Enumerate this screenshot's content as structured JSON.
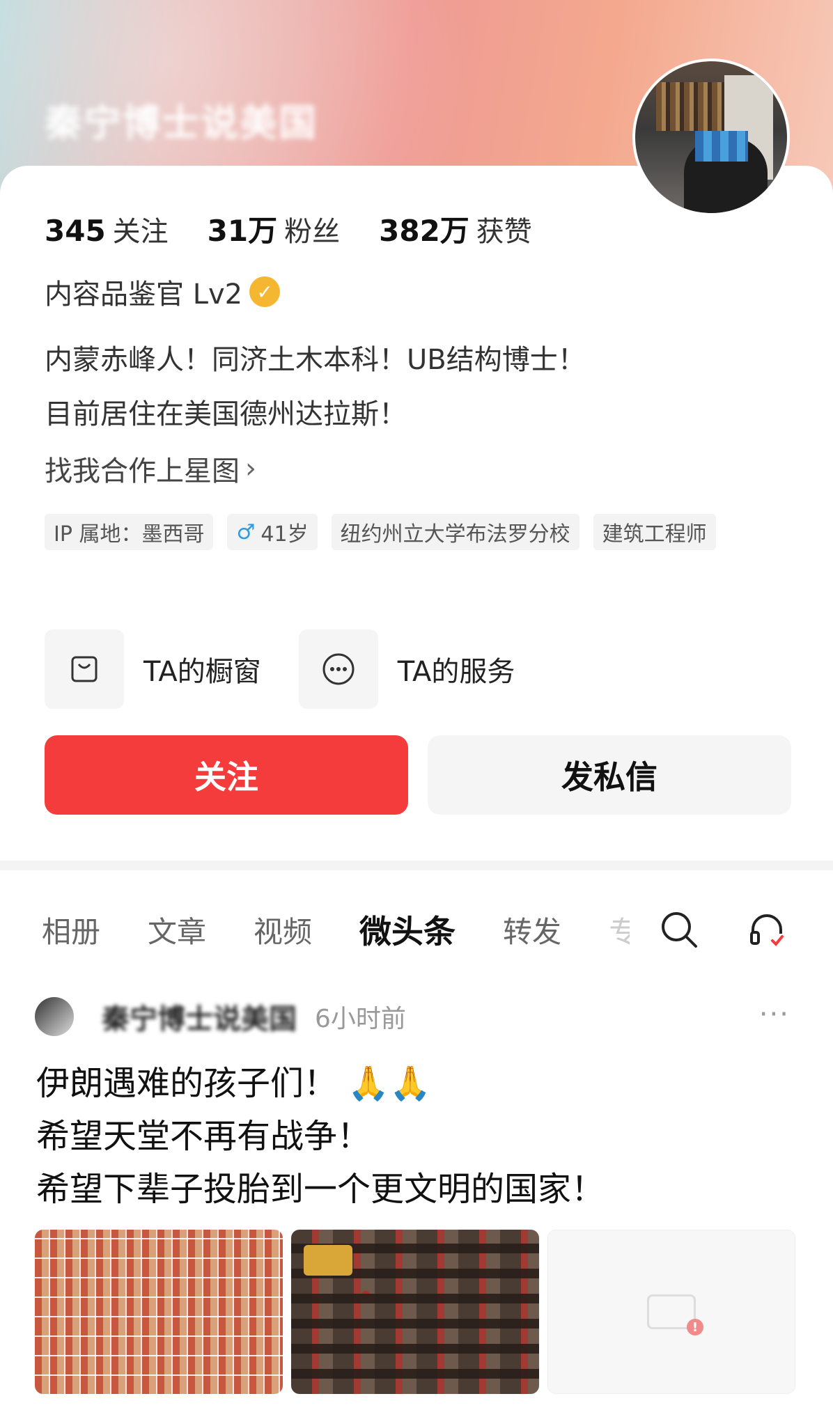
{
  "profile": {
    "username": "秦宁博士说美国",
    "stats": [
      {
        "value": "345",
        "label": "关注"
      },
      {
        "value": "31万",
        "label": "粉丝"
      },
      {
        "value": "382万",
        "label": "获赞"
      }
    ],
    "level": "内容品鉴官 Lv2",
    "bio_lines": [
      "内蒙赤峰人！同济土木本科！UB结构博士！",
      "目前居住在美国德州达拉斯！"
    ],
    "cooperate": "找我合作上星图",
    "tags": [
      "IP 属地：墨西哥",
      "41岁",
      "纽约州立大学布法罗分校",
      "建筑工程师"
    ],
    "services": [
      {
        "label": "TA的橱窗"
      },
      {
        "label": "TA的服务"
      }
    ],
    "follow_button": "关注",
    "message_button": "发私信"
  },
  "tabs": [
    "相册",
    "文章",
    "视频",
    "微头条",
    "转发",
    "专"
  ],
  "active_tab": "微头条",
  "post": {
    "author": "秦宁博士说美国",
    "time": "6小时前",
    "lines": [
      "伊朗遇难的孩子们！ 🙏🙏",
      "希望天堂不再有战争！",
      "希望下辈子投胎到一个更文明的国家！"
    ]
  },
  "colors": {
    "follow": "#f43c3c",
    "accent_badge": "#f5b731",
    "gender": "#2d9de0"
  }
}
